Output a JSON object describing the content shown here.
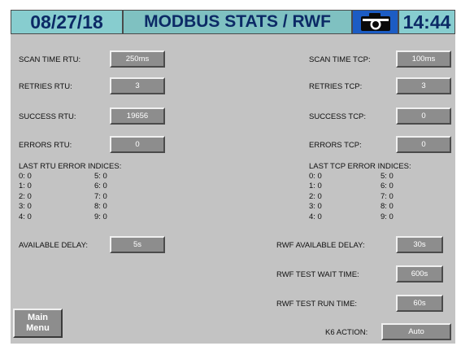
{
  "header": {
    "date": "08/27/18",
    "title": "MODBUS STATS / RWF",
    "time": "14:44",
    "camera_icon": "camera-icon"
  },
  "rtu": {
    "scan_time_label": "SCAN TIME RTU:",
    "scan_time_value": "250ms",
    "retries_label": "RETRIES RTU:",
    "retries_value": "3",
    "success_label": "SUCCESS RTU:",
    "success_value": "19656",
    "errors_label": "ERRORS RTU:",
    "errors_value": "0",
    "indices_title": "LAST RTU ERROR INDICES:",
    "indices_col1": [
      "0: 0",
      "1: 0",
      "2: 0",
      "3: 0",
      "4: 0"
    ],
    "indices_col2": [
      "5: 0",
      "6: 0",
      "7: 0",
      "8: 0",
      "9: 0"
    ],
    "available_delay_label": "AVAILABLE DELAY:",
    "available_delay_value": "5s"
  },
  "tcp": {
    "scan_time_label": "SCAN TIME TCP:",
    "scan_time_value": "100ms",
    "retries_label": "RETRIES TCP:",
    "retries_value": "3",
    "success_label": "SUCCESS TCP:",
    "success_value": "0",
    "errors_label": "ERRORS TCP:",
    "errors_value": "0",
    "indices_title": "LAST TCP ERROR INDICES:",
    "indices_col1": [
      "0: 0",
      "1: 0",
      "2: 0",
      "3: 0",
      "4: 0"
    ],
    "indices_col2": [
      "5: 0",
      "6: 0",
      "7: 0",
      "8: 0",
      "9: 0"
    ]
  },
  "rwf": {
    "available_delay_label": "RWF AVAILABLE  DELAY:",
    "available_delay_value": "30s",
    "test_wait_label": "RWF TEST WAIT TIME:",
    "test_wait_value": "600s",
    "test_run_label": "RWF TEST RUN TIME:",
    "test_run_value": "60s"
  },
  "k6": {
    "label": "K6 ACTION:",
    "value": "Auto"
  },
  "main_menu": {
    "line1": "Main",
    "line2": "Menu"
  }
}
